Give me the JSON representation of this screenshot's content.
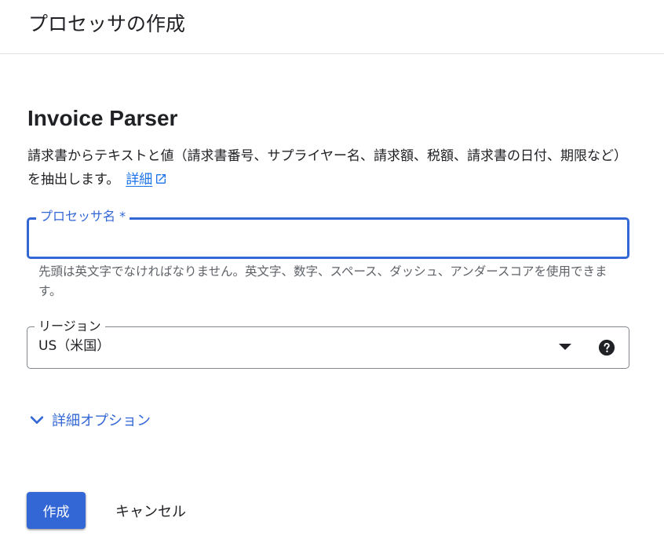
{
  "header": {
    "title": "プロセッサの作成"
  },
  "main": {
    "processor_type": "Invoice Parser",
    "description": "請求書からテキストと値（請求書番号、サプライヤー名、請求額、税額、請求書の日付、期限など）を抽出します。",
    "learn_more_label": "詳細",
    "learn_more_icon": "open-in-new-icon",
    "processor_name_field": {
      "label": "プロセッサ名 *",
      "value": "",
      "helper": "先頭は英文字でなければなりません。英文字、数字、スペース、ダッシュ、アンダースコアを使用できます。"
    },
    "region_field": {
      "label": "リージョン",
      "value": "US（米国）",
      "dropdown_icon": "arrow-drop-down-icon",
      "help_icon": "help-icon"
    },
    "advanced_options": {
      "label": "詳細オプション",
      "icon": "chevron-down-icon"
    }
  },
  "actions": {
    "create_label": "作成",
    "cancel_label": "キャンセル"
  },
  "colors": {
    "accent": "#3367d6",
    "link": "#1a73e8",
    "text": "#202124",
    "helper_text": "#5f6368"
  }
}
